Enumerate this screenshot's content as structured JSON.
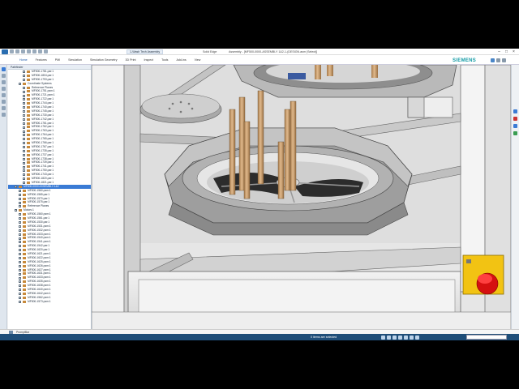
{
  "window": {
    "doc_tab": "1-Wash Tech Assembly",
    "app_name": "Solid Edge",
    "doc_title": "Assembly - [MF500-0000-ASSEMBLY 1&2-1-(DESIGN.asm (Select)]"
  },
  "ribbon": {
    "menu": [
      "Home",
      "Features",
      "PMI",
      "Simulation",
      "Simulation Geometry",
      "3D Print",
      "Inspect",
      "Tools",
      "Add-ins",
      "View"
    ],
    "active_index": 0,
    "brand": "SIEMENS"
  },
  "pathfinder": {
    "header": "Pathfinder",
    "rows": [
      {
        "label": "MF500-1781.par:1",
        "level": 3,
        "sel": false
      },
      {
        "label": "MF500-1804.par:1",
        "level": 3,
        "sel": false
      },
      {
        "label": "MF500-1793.par:1",
        "level": 3,
        "sel": false
      },
      {
        "label": "Coordinate Systems",
        "level": 2,
        "sel": false
      },
      {
        "label": "Reference Planes",
        "level": 3,
        "sel": false
      },
      {
        "label": "MF500-1751.psm:1",
        "level": 3,
        "sel": false
      },
      {
        "label": "MF500-1721.psm:1",
        "level": 3,
        "sel": false
      },
      {
        "label": "MF500-1722.par:1",
        "level": 3,
        "sel": false
      },
      {
        "label": "MF500-1744.par:1",
        "level": 3,
        "sel": false
      },
      {
        "label": "MF500-1740.par:1",
        "level": 3,
        "sel": false
      },
      {
        "label": "MF500-1745.par:1",
        "level": 3,
        "sel": false
      },
      {
        "label": "MF500-1730.par:1",
        "level": 3,
        "sel": false
      },
      {
        "label": "MF500-1742.par:1",
        "level": 3,
        "sel": false
      },
      {
        "label": "MF500-1761.par:1",
        "level": 3,
        "sel": false
      },
      {
        "label": "MF500-1762.par:1",
        "level": 3,
        "sel": false
      },
      {
        "label": "MF500-1763.par:1",
        "level": 3,
        "sel": false
      },
      {
        "label": "MF500-1764.par:1",
        "level": 3,
        "sel": false
      },
      {
        "label": "MF500-1765.par:1",
        "level": 3,
        "sel": false
      },
      {
        "label": "MF500-1766.par:1",
        "level": 3,
        "sel": false
      },
      {
        "label": "MF500-1767.par:1",
        "level": 3,
        "sel": false
      },
      {
        "label": "MF500-1735.par:1",
        "level": 3,
        "sel": false
      },
      {
        "label": "MF500-1737.par:1",
        "level": 3,
        "sel": false
      },
      {
        "label": "MF500-1738.par:1",
        "level": 3,
        "sel": false
      },
      {
        "label": "MF500-1739.par:1",
        "level": 3,
        "sel": false
      },
      {
        "label": "MF500-1741.par:1",
        "level": 3,
        "sel": false
      },
      {
        "label": "MF500-1750.par:1",
        "level": 3,
        "sel": false
      },
      {
        "label": "MF500-1743.par:1",
        "level": 3,
        "sel": false
      },
      {
        "label": "MF500-1820.par:1",
        "level": 3,
        "sel": false
      },
      {
        "label": "MF500-1821.par:1",
        "level": 3,
        "sel": false
      },
      {
        "label": "MF500-0000 ASSEMBLY-1&2",
        "level": 1,
        "sel": true
      },
      {
        "label": "MF500-1560.psm:1",
        "level": 2,
        "sel": false
      },
      {
        "label": "MF500-1565.par:1",
        "level": 2,
        "sel": false
      },
      {
        "label": "MF500-1570.par:1",
        "level": 2,
        "sel": false
      },
      {
        "label": "MF500-1575.par:1",
        "level": 2,
        "sel": false
      },
      {
        "label": "Reference Planes",
        "level": 2,
        "sel": false
      },
      {
        "label": "Motors:1",
        "level": 1,
        "sel": false
      },
      {
        "label": "MF500-1560.psm:1",
        "level": 2,
        "sel": false
      },
      {
        "label": "MF500-1561.par:1",
        "level": 2,
        "sel": false
      },
      {
        "label": "MF500-1530.par:1",
        "level": 2,
        "sel": false
      },
      {
        "label": "MF500-1531.psm:1",
        "level": 2,
        "sel": false
      },
      {
        "label": "MF500-1532.psm:1",
        "level": 2,
        "sel": false
      },
      {
        "label": "MF500-1533.psm:1",
        "level": 2,
        "sel": false
      },
      {
        "label": "MF500-1540.psm:1",
        "level": 2,
        "sel": false
      },
      {
        "label": "MF500-1541.psm:1",
        "level": 2,
        "sel": false
      },
      {
        "label": "MF500-1542.par:1",
        "level": 2,
        "sel": false
      },
      {
        "label": "MF500-1620.par:1",
        "level": 2,
        "sel": false
      },
      {
        "label": "MF500-1621.psm:1",
        "level": 2,
        "sel": false
      },
      {
        "label": "MF500-1622.psm:1",
        "level": 2,
        "sel": false
      },
      {
        "label": "MF500-1625.psm:1",
        "level": 2,
        "sel": false
      },
      {
        "label": "MF500-1626.psm:1",
        "level": 2,
        "sel": false
      },
      {
        "label": "MF500-1627.psm:1",
        "level": 2,
        "sel": false
      },
      {
        "label": "MF500-1631.psm:1",
        "level": 2,
        "sel": false
      },
      {
        "label": "MF500-1633.psm:1",
        "level": 2,
        "sel": false
      },
      {
        "label": "MF500-1635.psm:1",
        "level": 2,
        "sel": false
      },
      {
        "label": "MF500-1638.psm:1",
        "level": 2,
        "sel": false
      },
      {
        "label": "MF500-1640.psm:1",
        "level": 2,
        "sel": false
      },
      {
        "label": "MF500-1642.psm:1",
        "level": 2,
        "sel": false
      },
      {
        "label": "MF500-1562.psm:1",
        "level": 2,
        "sel": false
      },
      {
        "label": "MF500-1573.psm:1",
        "level": 2,
        "sel": false
      }
    ],
    "status": "Not Enabled (Design): Ribbons"
  },
  "prompt": {
    "label": "PromptBar"
  },
  "status": {
    "message": "0 items are selected"
  },
  "colors": {
    "selected": "#3a7bd5",
    "status_bar": "#1f4e79",
    "brand": "#119aa4",
    "estop_red": "#d51010",
    "estop_yellow": "#f2c313",
    "brass": "#c89d6a"
  }
}
